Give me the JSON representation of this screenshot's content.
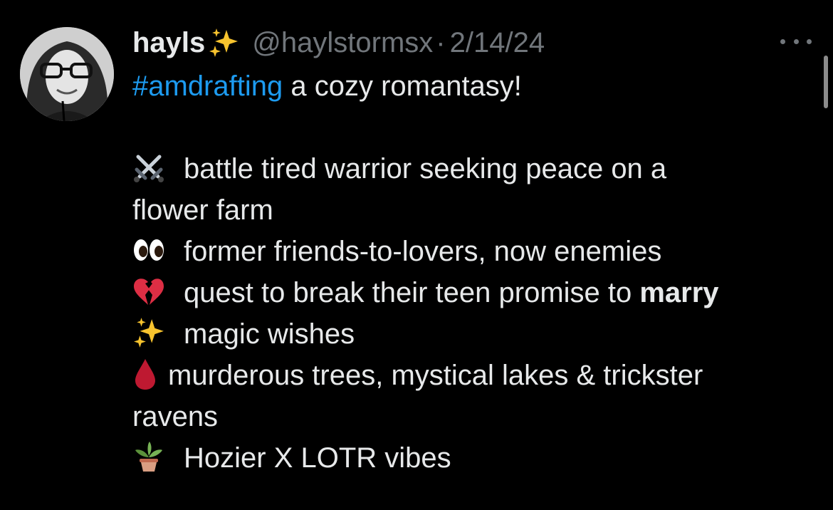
{
  "tweet": {
    "display_name": "hayls",
    "handle": "@haylstormsx",
    "separator": "·",
    "date": "2/14/24",
    "hashtag": "#amdrafting",
    "intro": " a cozy romantasy!",
    "items": [
      {
        "icon": "crossed-swords-icon",
        "line1": "battle tired warrior seeking peace on a",
        "line2": "flower farm"
      },
      {
        "icon": "eyes-icon",
        "text": "former friends-to-lovers, now enemies"
      },
      {
        "icon": "broken-heart-icon",
        "text_before": "quest to break their teen promise to ",
        "text_bold": "marry"
      },
      {
        "icon": "sparkles-icon",
        "text": "magic wishes"
      },
      {
        "icon": "drop-of-blood-icon",
        "line1": "murderous trees, mystical lakes & trickster",
        "line2": "ravens"
      },
      {
        "icon": "potted-plant-icon",
        "text": "Hozier X LOTR vibes"
      }
    ]
  },
  "colors": {
    "background": "#000000",
    "text": "#e7e9ea",
    "muted": "#71767b",
    "link": "#1d9bf0"
  }
}
